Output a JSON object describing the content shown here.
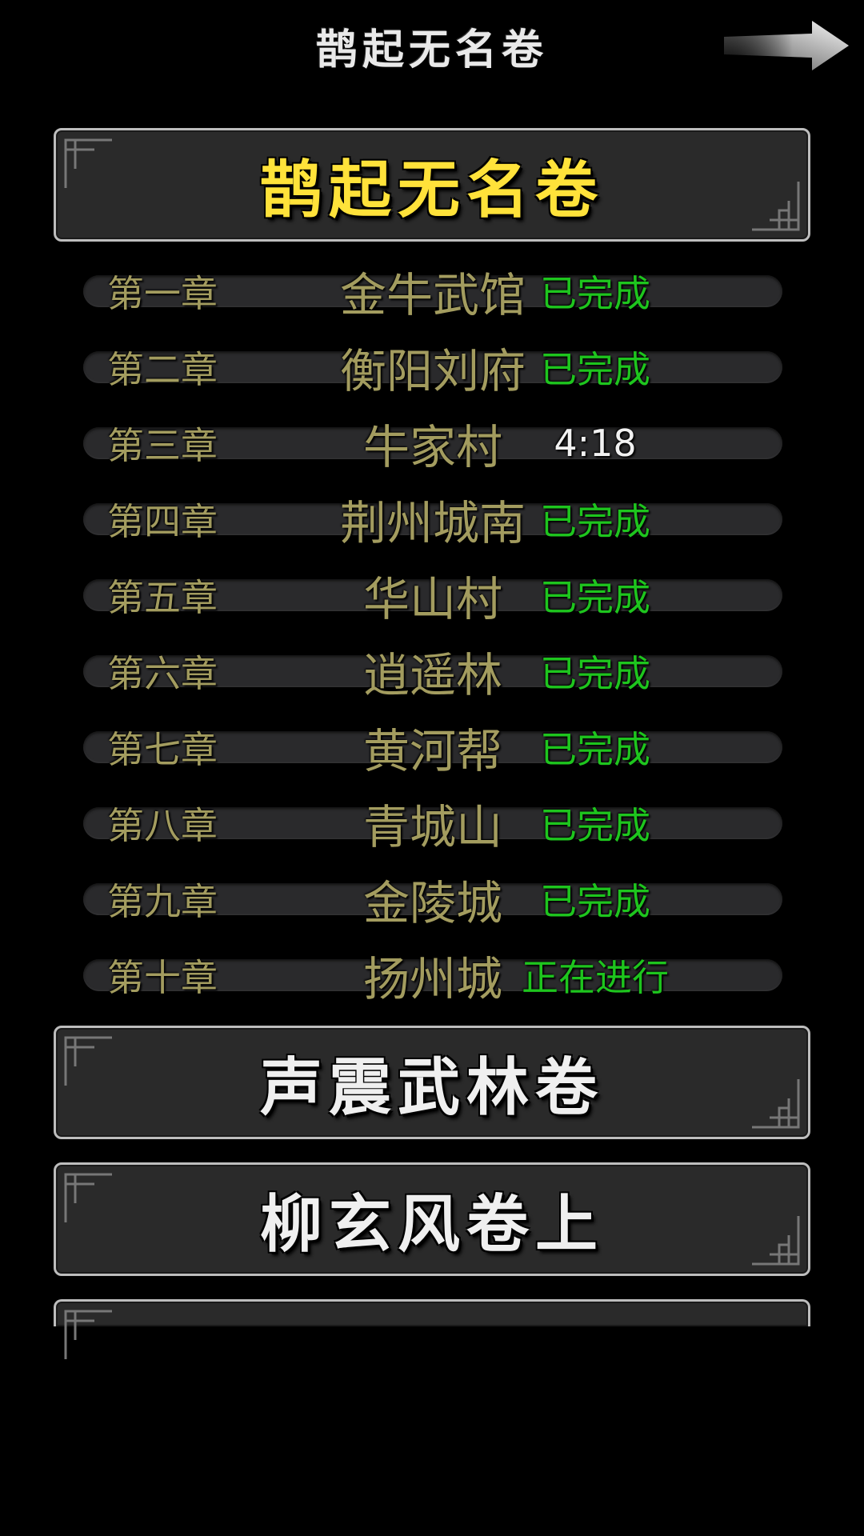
{
  "header": {
    "title": "鹊起无名卷",
    "next_icon": "arrow-right-icon"
  },
  "volumes": [
    {
      "title": "鹊起无名卷",
      "expanded": true,
      "chapters": [
        {
          "number": "第一章",
          "name": "金牛武馆",
          "status": "已完成",
          "status_type": "done"
        },
        {
          "number": "第二章",
          "name": "衡阳刘府",
          "status": "已完成",
          "status_type": "done"
        },
        {
          "number": "第三章",
          "name": "牛家村",
          "status": "4:18",
          "status_type": "timer"
        },
        {
          "number": "第四章",
          "name": "荆州城南",
          "status": "已完成",
          "status_type": "done"
        },
        {
          "number": "第五章",
          "name": "华山村",
          "status": "已完成",
          "status_type": "done"
        },
        {
          "number": "第六章",
          "name": "逍遥林",
          "status": "已完成",
          "status_type": "done"
        },
        {
          "number": "第七章",
          "name": "黄河帮",
          "status": "已完成",
          "status_type": "done"
        },
        {
          "number": "第八章",
          "name": "青城山",
          "status": "已完成",
          "status_type": "done"
        },
        {
          "number": "第九章",
          "name": "金陵城",
          "status": "已完成",
          "status_type": "done"
        },
        {
          "number": "第十章",
          "name": "扬州城",
          "status": "正在进行",
          "status_type": "progress"
        }
      ]
    },
    {
      "title": "声震武林卷",
      "expanded": false
    },
    {
      "title": "柳玄风卷上",
      "expanded": false
    },
    {
      "title": "",
      "expanded": false
    }
  ],
  "colors": {
    "background": "#000000",
    "active_volume_title": "#ffe23a",
    "volume_title": "#efefef",
    "chapter_text": "#a39c5f",
    "status_done": "#1ec51e",
    "status_timer": "#f2f2f2"
  }
}
